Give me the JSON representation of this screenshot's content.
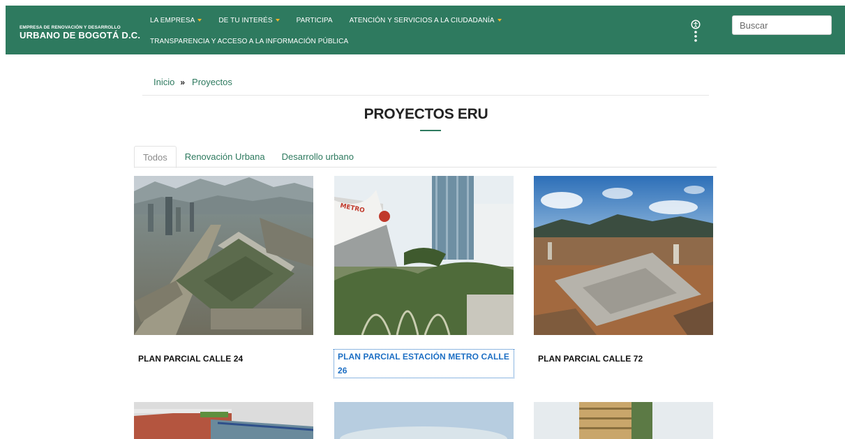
{
  "header": {
    "logo_small": "Empresa de Renovación y Desarrollo",
    "logo_big": "URBANO DE BOGOTÁ D.C.",
    "nav_row1": [
      {
        "label": "LA EMPRESA",
        "dropdown": true
      },
      {
        "label": "DE TU INTERÉS",
        "dropdown": true
      },
      {
        "label": "PARTICIPA",
        "dropdown": false
      },
      {
        "label": "ATENCIÓN Y SERVICIOS A LA CIUDADANÍA",
        "dropdown": true
      }
    ],
    "nav_row2": [
      {
        "label": "TRANSPARENCIA Y ACCESO A LA INFORMACIÓN PÚBLICA",
        "dropdown": false
      }
    ],
    "search_placeholder": "Buscar",
    "accessibility_icon": "accessibility-icon"
  },
  "breadcrumb": {
    "home": "Inicio",
    "separator": "»",
    "current": "Proyectos"
  },
  "page_title": "PROYECTOS ERU",
  "tabs": [
    {
      "label": "Todos",
      "active": true
    },
    {
      "label": "Renovación Urbana",
      "active": false
    },
    {
      "label": "Desarrollo urbano",
      "active": false
    }
  ],
  "projects": [
    {
      "title": "PLAN PARCIAL CALLE 24"
    },
    {
      "title": "PLAN PARCIAL ESTACIÓN METRO CALLE 26"
    },
    {
      "title": "PLAN PARCIAL CALLE 72"
    }
  ],
  "render_labels": {
    "metro_sign": "METRO"
  },
  "colors": {
    "brand_green": "#2e7a5f",
    "nav_caret": "#f0b429",
    "link_focus": "#1d6fc4"
  }
}
